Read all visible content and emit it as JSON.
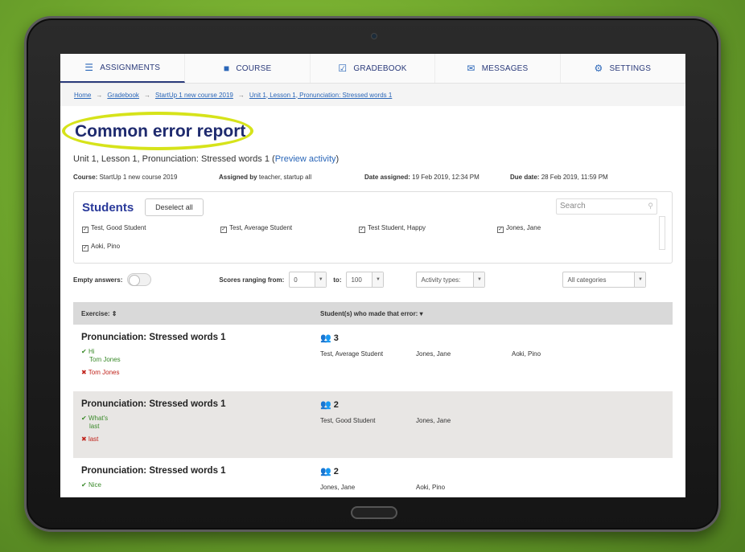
{
  "nav": {
    "items": [
      {
        "label": "ASSIGNMENTS",
        "icon": "assignments-icon"
      },
      {
        "label": "COURSE",
        "icon": "book-icon"
      },
      {
        "label": "GRADEBOOK",
        "icon": "gradebook-icon"
      },
      {
        "label": "MESSAGES",
        "icon": "messages-icon"
      },
      {
        "label": "SETTINGS",
        "icon": "gear-icon"
      }
    ]
  },
  "breadcrumbs": [
    "Home",
    "Gradebook",
    "StartUp 1 new course 2019",
    "Unit 1, Lesson 1, Pronunciation: Stressed words 1"
  ],
  "page": {
    "title": "Common error report",
    "subtitle": "Unit 1, Lesson 1, Pronunciation: Stressed words 1",
    "preview_link": "Preview activity",
    "course_label": "Course:",
    "course_value": "StartUp 1 new course 2019",
    "assigned_label": "Assigned by",
    "assigned_value": "teacher, startup all",
    "date_label": "Date assigned:",
    "date_value": "19 Feb 2019, 12:34 PM",
    "due_label": "Due date:",
    "due_value": "28 Feb 2019, 11:59 PM"
  },
  "students": {
    "title": "Students",
    "deselect_label": "Deselect all",
    "search_placeholder": "Search",
    "list": [
      "Test, Good Student",
      "Test, Average Student",
      "Test Student, Happy",
      "Jones, Jane",
      "Aoki, Pino"
    ]
  },
  "filters": {
    "empty_answers_label": "Empty answers:",
    "scores_label": "Scores ranging from:",
    "from_value": "0",
    "to_label": "to:",
    "to_value": "100",
    "activity_types": "Activity types:",
    "categories": "All categories"
  },
  "table": {
    "col_exercise": "Exercise: ⇕",
    "col_students": "Student(s) who made that error: ▾",
    "rows": [
      {
        "title": "Pronunciation: Stressed words 1",
        "ok1": "Hi",
        "ok2": "Tom Jones",
        "bad": "Tom Jones",
        "count": "3",
        "names": [
          "Test, Average Student",
          "Jones, Jane",
          "Aoki, Pino"
        ]
      },
      {
        "title": "Pronunciation: Stressed words 1",
        "ok1": "What's",
        "ok2": "last",
        "bad": "last",
        "count": "2",
        "names": [
          "Test, Good Student",
          "Jones, Jane"
        ]
      },
      {
        "title": "Pronunciation: Stressed words 1",
        "ok1": "Nice",
        "ok2": "",
        "bad": "",
        "count": "2",
        "names": [
          "Jones, Jane",
          "Aoki, Pino"
        ]
      }
    ]
  },
  "colors": {
    "accent": "#2a3a7a",
    "highlight": "#d6e31a",
    "ok": "#3a8a2a",
    "bad": "#c0241c"
  }
}
